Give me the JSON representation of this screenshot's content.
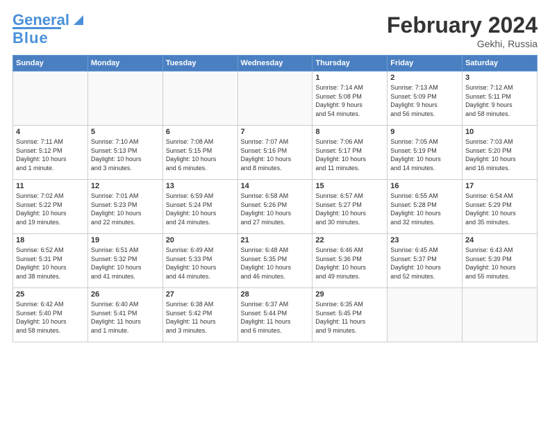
{
  "header": {
    "logo_line1": "General",
    "logo_line2": "Blue",
    "month_title": "February 2024",
    "location": "Gekhi, Russia"
  },
  "calendar": {
    "days_of_week": [
      "Sunday",
      "Monday",
      "Tuesday",
      "Wednesday",
      "Thursday",
      "Friday",
      "Saturday"
    ],
    "weeks": [
      [
        {
          "num": "",
          "info": ""
        },
        {
          "num": "",
          "info": ""
        },
        {
          "num": "",
          "info": ""
        },
        {
          "num": "",
          "info": ""
        },
        {
          "num": "1",
          "info": "Sunrise: 7:14 AM\nSunset: 5:08 PM\nDaylight: 9 hours\nand 54 minutes."
        },
        {
          "num": "2",
          "info": "Sunrise: 7:13 AM\nSunset: 5:09 PM\nDaylight: 9 hours\nand 56 minutes."
        },
        {
          "num": "3",
          "info": "Sunrise: 7:12 AM\nSunset: 5:11 PM\nDaylight: 9 hours\nand 58 minutes."
        }
      ],
      [
        {
          "num": "4",
          "info": "Sunrise: 7:11 AM\nSunset: 5:12 PM\nDaylight: 10 hours\nand 1 minute."
        },
        {
          "num": "5",
          "info": "Sunrise: 7:10 AM\nSunset: 5:13 PM\nDaylight: 10 hours\nand 3 minutes."
        },
        {
          "num": "6",
          "info": "Sunrise: 7:08 AM\nSunset: 5:15 PM\nDaylight: 10 hours\nand 6 minutes."
        },
        {
          "num": "7",
          "info": "Sunrise: 7:07 AM\nSunset: 5:16 PM\nDaylight: 10 hours\nand 8 minutes."
        },
        {
          "num": "8",
          "info": "Sunrise: 7:06 AM\nSunset: 5:17 PM\nDaylight: 10 hours\nand 11 minutes."
        },
        {
          "num": "9",
          "info": "Sunrise: 7:05 AM\nSunset: 5:19 PM\nDaylight: 10 hours\nand 14 minutes."
        },
        {
          "num": "10",
          "info": "Sunrise: 7:03 AM\nSunset: 5:20 PM\nDaylight: 10 hours\nand 16 minutes."
        }
      ],
      [
        {
          "num": "11",
          "info": "Sunrise: 7:02 AM\nSunset: 5:22 PM\nDaylight: 10 hours\nand 19 minutes."
        },
        {
          "num": "12",
          "info": "Sunrise: 7:01 AM\nSunset: 5:23 PM\nDaylight: 10 hours\nand 22 minutes."
        },
        {
          "num": "13",
          "info": "Sunrise: 6:59 AM\nSunset: 5:24 PM\nDaylight: 10 hours\nand 24 minutes."
        },
        {
          "num": "14",
          "info": "Sunrise: 6:58 AM\nSunset: 5:26 PM\nDaylight: 10 hours\nand 27 minutes."
        },
        {
          "num": "15",
          "info": "Sunrise: 6:57 AM\nSunset: 5:27 PM\nDaylight: 10 hours\nand 30 minutes."
        },
        {
          "num": "16",
          "info": "Sunrise: 6:55 AM\nSunset: 5:28 PM\nDaylight: 10 hours\nand 32 minutes."
        },
        {
          "num": "17",
          "info": "Sunrise: 6:54 AM\nSunset: 5:29 PM\nDaylight: 10 hours\nand 35 minutes."
        }
      ],
      [
        {
          "num": "18",
          "info": "Sunrise: 6:52 AM\nSunset: 5:31 PM\nDaylight: 10 hours\nand 38 minutes."
        },
        {
          "num": "19",
          "info": "Sunrise: 6:51 AM\nSunset: 5:32 PM\nDaylight: 10 hours\nand 41 minutes."
        },
        {
          "num": "20",
          "info": "Sunrise: 6:49 AM\nSunset: 5:33 PM\nDaylight: 10 hours\nand 44 minutes."
        },
        {
          "num": "21",
          "info": "Sunrise: 6:48 AM\nSunset: 5:35 PM\nDaylight: 10 hours\nand 46 minutes."
        },
        {
          "num": "22",
          "info": "Sunrise: 6:46 AM\nSunset: 5:36 PM\nDaylight: 10 hours\nand 49 minutes."
        },
        {
          "num": "23",
          "info": "Sunrise: 6:45 AM\nSunset: 5:37 PM\nDaylight: 10 hours\nand 52 minutes."
        },
        {
          "num": "24",
          "info": "Sunrise: 6:43 AM\nSunset: 5:39 PM\nDaylight: 10 hours\nand 55 minutes."
        }
      ],
      [
        {
          "num": "25",
          "info": "Sunrise: 6:42 AM\nSunset: 5:40 PM\nDaylight: 10 hours\nand 58 minutes."
        },
        {
          "num": "26",
          "info": "Sunrise: 6:40 AM\nSunset: 5:41 PM\nDaylight: 11 hours\nand 1 minute."
        },
        {
          "num": "27",
          "info": "Sunrise: 6:38 AM\nSunset: 5:42 PM\nDaylight: 11 hours\nand 3 minutes."
        },
        {
          "num": "28",
          "info": "Sunrise: 6:37 AM\nSunset: 5:44 PM\nDaylight: 11 hours\nand 6 minutes."
        },
        {
          "num": "29",
          "info": "Sunrise: 6:35 AM\nSunset: 5:45 PM\nDaylight: 11 hours\nand 9 minutes."
        },
        {
          "num": "",
          "info": ""
        },
        {
          "num": "",
          "info": ""
        }
      ]
    ]
  }
}
